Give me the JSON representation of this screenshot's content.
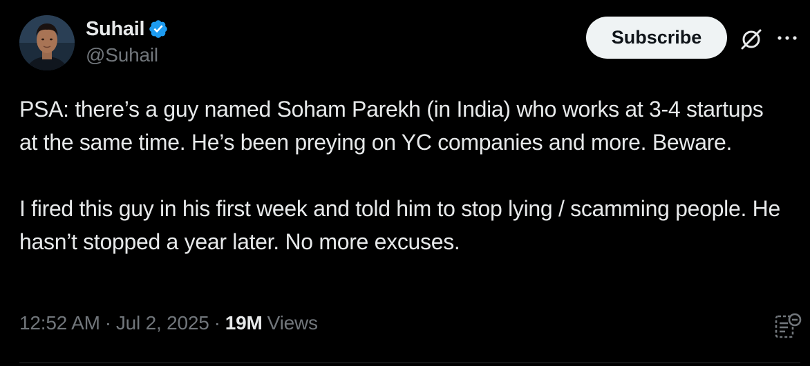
{
  "author": {
    "display_name": "Suhail",
    "handle": "@Suhail",
    "verified": true,
    "verified_color": "#1d9bf0"
  },
  "header": {
    "subscribe_label": "Subscribe",
    "grok_icon": "grok-slash-icon",
    "more_icon": "more-dots-icon"
  },
  "tweet": {
    "paragraphs": [
      "PSA: there’s a guy named Soham Parekh (in India) who works at 3-4 startups at the same time. He’s been preying on YC companies and more. Beware.",
      "I fired this guy in his first week and told him to stop lying / scamming people. He hasn’t stopped a year later. No more excuses."
    ]
  },
  "meta": {
    "time": "12:52 AM",
    "separator": "·",
    "date": "Jul 2, 2025",
    "views_count": "19M",
    "views_label": "Views"
  },
  "colors": {
    "background": "#000000",
    "text_primary": "#e7e9ea",
    "text_secondary": "#71767b",
    "button_bg": "#eff3f4"
  }
}
